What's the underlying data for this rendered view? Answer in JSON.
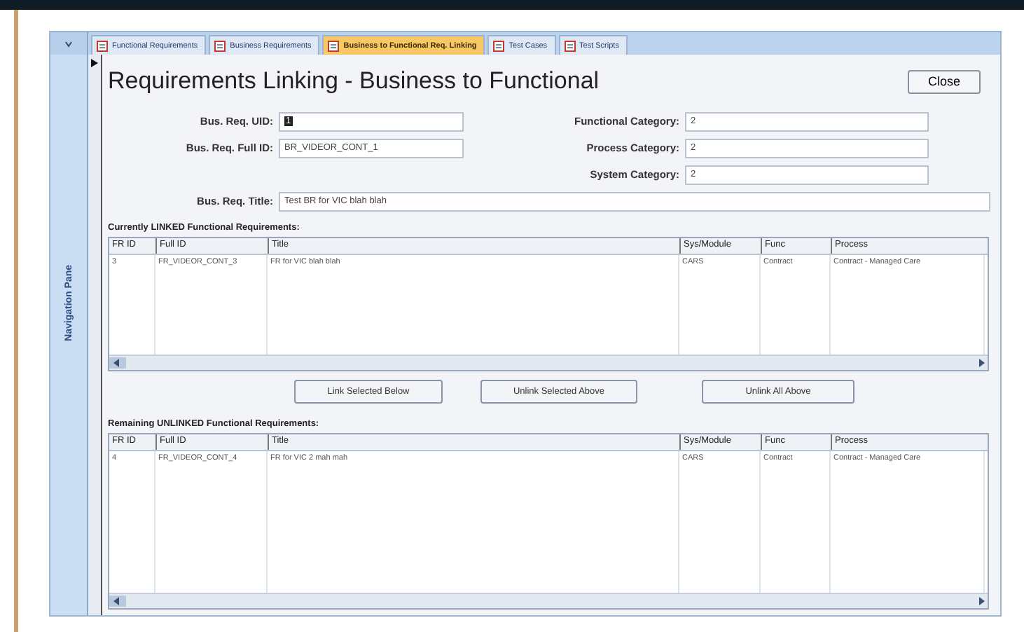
{
  "tabs": [
    {
      "label": "Functional Requirements",
      "selected": false
    },
    {
      "label": "Business Requirements",
      "selected": false
    },
    {
      "label": "Business to Functional Req. Linking",
      "selected": true
    },
    {
      "label": "Test Cases",
      "selected": false
    },
    {
      "label": "Test Scripts",
      "selected": false
    }
  ],
  "navigation_pane": {
    "label": "Navigation Pane"
  },
  "form": {
    "title": "Requirements Linking - Business to Functional",
    "close_button": "Close",
    "left_fields": [
      {
        "label": "Bus. Req. UID:",
        "value": "1",
        "focused": true
      },
      {
        "label": "Bus. Req. Full ID:",
        "value": "BR_VIDEOR_CONT_1",
        "focused": false
      }
    ],
    "right_fields": [
      {
        "label": "Functional Category:",
        "value": "2",
        "focused": false
      },
      {
        "label": "Process Category:",
        "value": "2",
        "focused": false
      },
      {
        "label": "System Category:",
        "value": "2",
        "focused": false
      }
    ],
    "title_field": {
      "label": "Bus. Req. Title:",
      "value": "Test BR for VIC blah blah",
      "focused": false
    },
    "linked": {
      "heading": "Currently LINKED Functional Requirements:",
      "columns": [
        "FR ID",
        "Full ID",
        "Title",
        "Sys/Module",
        "Func",
        "Process"
      ],
      "rows": [
        [
          "3",
          "FR_VIDEOR_CONT_3",
          "FR for VIC blah blah",
          "CARS",
          "Contract",
          "Contract - Managed Care"
        ]
      ]
    },
    "buttons": [
      "Link Selected Below",
      "Unlink Selected Above",
      "Unlink All Above"
    ],
    "unlinked": {
      "heading": "Remaining UNLINKED Functional Requirements:",
      "columns": [
        "FR ID",
        "Full ID",
        "Title",
        "Sys/Module",
        "Func",
        "Process"
      ],
      "rows": [
        [
          "4",
          "FR_VIDEOR_CONT_4",
          "FR for VIC 2 mah mah",
          "CARS",
          "Contract",
          "Contract - Managed Care"
        ]
      ]
    }
  }
}
